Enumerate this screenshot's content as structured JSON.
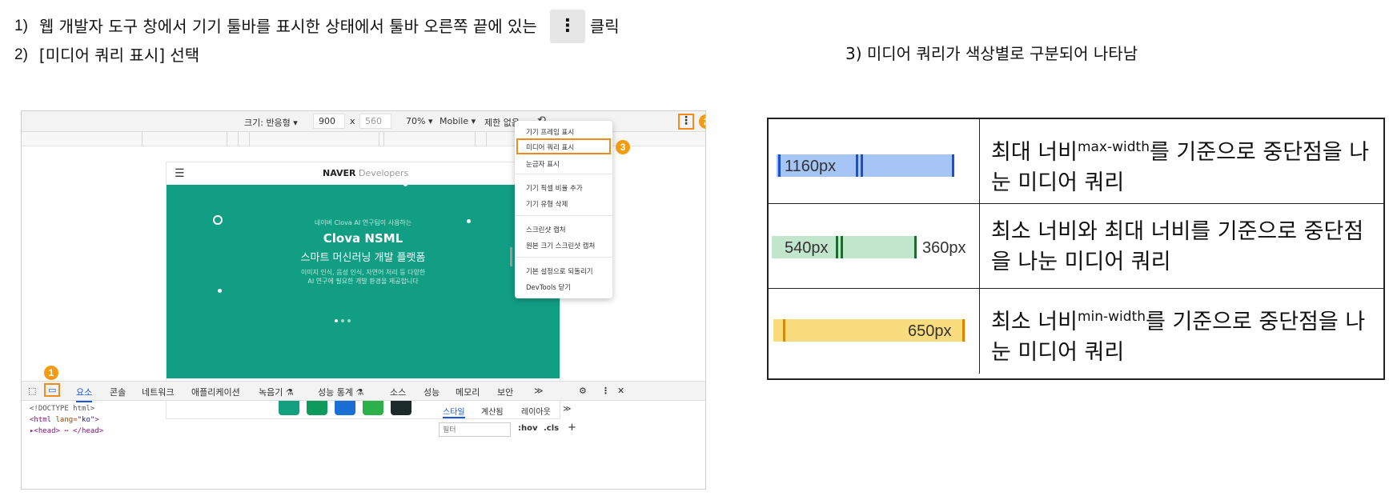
{
  "steps": {
    "s1": {
      "num": "1)",
      "text": "웹 개발자 도구 창에서 기기 툴바를 표시한 상태에서 툴바 오른쪽 끝에 있는",
      "icon": "⋮",
      "tail": "클릭"
    },
    "s2": {
      "num": "2)",
      "text": "[미디어 쿼리 표시] 선택"
    },
    "s3": {
      "text": "3) 미디어 쿼리가 색상별로 구분되어 나타남"
    }
  },
  "device_toolbar": {
    "size_label": "크기: 반응형 ▾",
    "width": "900",
    "times": "x",
    "height": "560",
    "zoom": "70% ▾",
    "mobile": "Mobile ▾",
    "throttle": "제한 없음 ▾",
    "more_icon": "⋮",
    "badge_more": "2"
  },
  "emulated_page": {
    "brand_bold": "NAVER",
    "brand_light": " Developers",
    "hero_small": "네이버 Clova AI 연구팀이 사용하는",
    "hero_title": "Clova NSML",
    "hero_subtitle": "스마트 머신러닝 개발 플랫폼",
    "hero_desc1": "이미지 인식, 음성 인식, 자연어 처리 등 다양한",
    "hero_desc2": "AI 연구에 필요한 개발 환경을 제공합니다"
  },
  "context_menu": {
    "items": [
      "기기 프레임 표시",
      "미디어 쿼리 표시",
      "눈금자 표시",
      "기기 픽셀 비율 추가",
      "기기 유형 삭제",
      "스크린샷 캡처",
      "원본 크기 스크린샷 캡처",
      "기본 설정으로 되돌리기",
      "DevTools 닫기"
    ],
    "badge_selected": "3"
  },
  "devtools_tabs": {
    "items": [
      "요소",
      "콘솔",
      "네트워크",
      "애플리케이션",
      "녹음기 ⚗",
      "성능 통계 ⚗",
      "소스",
      "성능",
      "메모리",
      "보안",
      "≫"
    ],
    "icons": {
      "settings": "⚙",
      "more": "⋮",
      "close": "✕",
      "device": "▭"
    },
    "badge_device": "1"
  },
  "elements_code": {
    "line1": "<!DOCTYPE html>",
    "line2_tag_open": "<html ",
    "line2_attr": "lang=",
    "line2_val": "\"ko\"",
    "line2_tag_close": ">",
    "line3": "▸<head> ⋯ </head>"
  },
  "styles_pane": {
    "tabs": [
      "스타일",
      "계산됨",
      "레이아웃",
      "≫"
    ],
    "filter_placeholder": "필터",
    "hov": ":hov",
    "cls": ".cls",
    "plus": "+"
  },
  "legend": {
    "rows": [
      {
        "bar_label_left": "1160px",
        "bar_label_right": "",
        "color": "#a6c5f7",
        "text_a": "최대 너비",
        "sup": "max-width",
        "text_b": "를 기준으로 중단점을 나눈 미디어 쿼리"
      },
      {
        "bar_label_left": "540px",
        "bar_label_right": "360px",
        "color": "#c2e6cc",
        "text_a": "최소 너비와 최대 너비를 기준으로 중단점을 나눈 미디어 쿼리",
        "sup": "",
        "text_b": ""
      },
      {
        "bar_label_left": "",
        "bar_label_right": "650px",
        "color": "#f8dc7d",
        "text_a": "최소 너비",
        "sup": "min-width",
        "text_b": "를 기준으로 중단점을 나눈 미디어 쿼리"
      }
    ]
  }
}
